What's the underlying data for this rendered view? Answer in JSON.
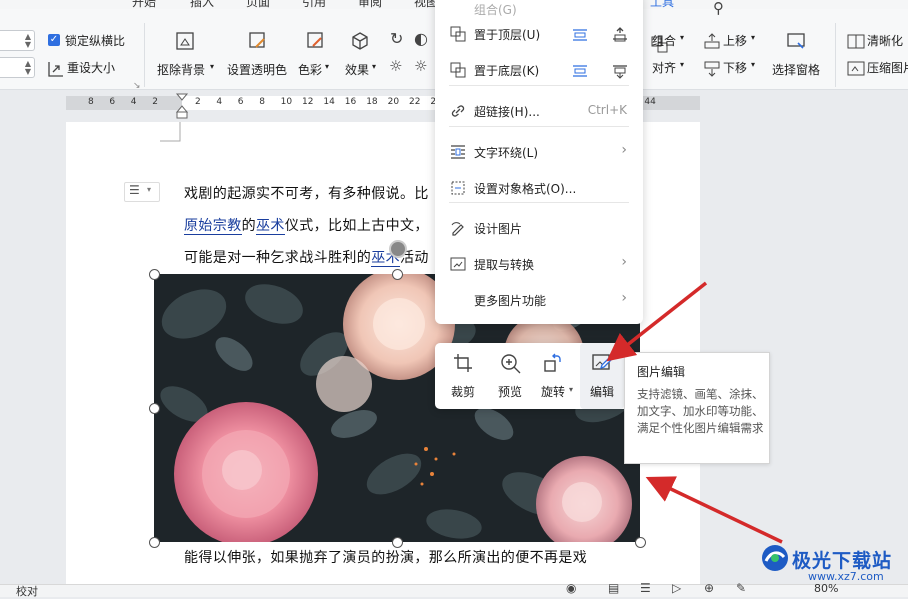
{
  "ribbon": {
    "tabs": [
      "开始",
      "插入",
      "页面",
      "引用",
      "审阅",
      "视图",
      "工具"
    ],
    "lock_ratio_label": "锁定纵横比",
    "reset_size_label": "重设大小",
    "remove_bg_label": "抠除背景",
    "transparency_label": "设置透明色",
    "color_label": "色彩",
    "effects_label": "效果",
    "group_label": "组合",
    "align_label": "对齐",
    "move_up_label": "上移",
    "move_down_label": "下移",
    "selection_pane_label": "选择窗格",
    "sharpen_label": "清晰化",
    "compress_label": "压缩图片"
  },
  "ruler": {
    "ticks": [
      "8",
      "6",
      "4",
      "2",
      "",
      "2",
      "4",
      "6",
      "8",
      "10",
      "12",
      "14",
      "16",
      "18",
      "20",
      "22",
      "24",
      "26",
      "28",
      "30",
      "32",
      "34",
      "36",
      "38",
      "40",
      "42",
      "44"
    ]
  },
  "document": {
    "line1": "戏剧的起源实不可考，有多种假说。比",
    "line2_link1": "原始宗教",
    "line2_mid": "的",
    "line2_link2": "巫术",
    "line2_rest": "仪式，比如上古中文，",
    "line3_pre": "可能是对一种乞求战斗胜利的",
    "line3_link": "巫术",
    "line3_post": "活动",
    "line4": "能得以伸张，如果抛弃了演员的扮演，那么所演出的便不再是戏"
  },
  "context_menu": {
    "items": [
      {
        "label": "组合(G)",
        "icon": "group-icon"
      },
      {
        "label": "置于顶层(U)",
        "icon": "bring-to-front-icon"
      },
      {
        "label": "置于底层(K)",
        "icon": "send-to-back-icon"
      },
      {
        "label": "超链接(H)...",
        "shortcut": "Ctrl+K",
        "icon": "hyperlink-icon"
      },
      {
        "label": "文字环绕(L)",
        "icon": "text-wrap-icon"
      },
      {
        "label": "设置对象格式(O)...",
        "icon": "format-object-icon"
      },
      {
        "label": "设计图片",
        "icon": "design-image-icon"
      },
      {
        "label": "提取与转换",
        "icon": "extract-icon"
      },
      {
        "label": "更多图片功能",
        "icon": ""
      }
    ]
  },
  "float_toolbar": {
    "crop": "裁剪",
    "preview": "预览",
    "rotate": "旋转",
    "edit": "编辑"
  },
  "tooltip": {
    "title": "图片编辑",
    "body": "支持滤镜、画笔、涂抹、加文字、加水印等功能、满足个性化图片编辑需求"
  },
  "status_bar": {
    "left": "校对",
    "zoom": "80%"
  },
  "watermark": {
    "name": "极光下载站",
    "url": "www.xz7.com"
  },
  "colors": {
    "accent": "#2f6fe0",
    "arrow": "#d42a2a",
    "link": "#1a3e9e"
  }
}
